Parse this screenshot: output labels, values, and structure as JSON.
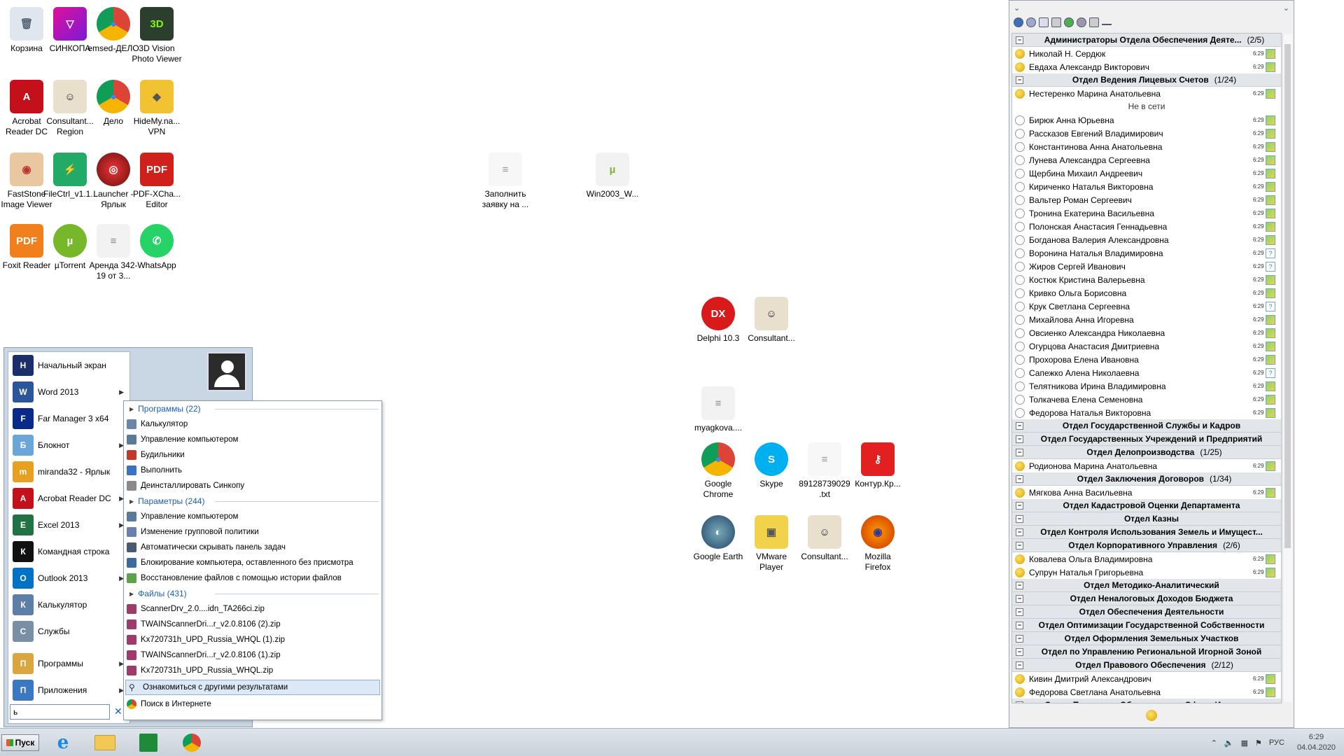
{
  "desktop": {
    "icons": [
      {
        "label": "Корзина",
        "icon": "recycle-bin-icon"
      },
      {
        "label": "СИНКОПА",
        "icon": "sinkopa-icon"
      },
      {
        "label": "emsed-ДЕЛО",
        "icon": "chrome-icon"
      },
      {
        "label": "3D Vision Photo Viewer",
        "icon": "3d-vision-icon"
      },
      {
        "label": "Acrobat Reader DC",
        "icon": "acrobat-icon"
      },
      {
        "label": "Consultant... Region",
        "icon": "consultant-icon"
      },
      {
        "label": "Дело",
        "icon": "chrome-icon"
      },
      {
        "label": "HideMy.na... VPN",
        "icon": "vpn-icon"
      },
      {
        "label": "FastStone Image Viewer",
        "icon": "faststone-icon"
      },
      {
        "label": "FileCtrl_v1.1...",
        "icon": "filectrl-icon"
      },
      {
        "label": "Launcher - Ярлык",
        "icon": "launcher-icon"
      },
      {
        "label": "PDF-XCha... Editor",
        "icon": "pdf-xchange-icon"
      },
      {
        "label": "Foxit Reader",
        "icon": "foxit-icon"
      },
      {
        "label": "µTorrent",
        "icon": "utorrent-icon"
      },
      {
        "label": "Аренда 342-19 от 3...",
        "icon": "document-icon"
      },
      {
        "label": "WhatsApp",
        "icon": "whatsapp-icon"
      },
      {
        "label": "Заполнить заявку на ...",
        "icon": "text-file-icon"
      },
      {
        "label": "Win2003_W...",
        "icon": "torrent-file-icon"
      },
      {
        "label": "Delphi 10.3",
        "icon": "delphi-icon"
      },
      {
        "label": "Consultant...",
        "icon": "consultant-icon"
      },
      {
        "label": "myagkova....",
        "icon": "document-icon"
      },
      {
        "label": "Google Chrome",
        "icon": "chrome-icon"
      },
      {
        "label": "Skype",
        "icon": "skype-icon"
      },
      {
        "label": "89128739029 .txt",
        "icon": "text-file-icon"
      },
      {
        "label": "Контур.Кр...",
        "icon": "kontur-icon"
      },
      {
        "label": "Google Earth",
        "icon": "google-earth-icon"
      },
      {
        "label": "VMware Player",
        "icon": "vmware-icon"
      },
      {
        "label": "Consultant...",
        "icon": "consultant-icon"
      },
      {
        "label": "Mozilla Firefox",
        "icon": "firefox-icon"
      }
    ]
  },
  "start_menu": {
    "items": [
      {
        "label": "Начальный экран",
        "icon": "start-screen-icon",
        "color": "#1c2d6b",
        "submenu": false
      },
      {
        "label": "Word 2013",
        "icon": "word-icon",
        "color": "#2b579a",
        "submenu": true
      },
      {
        "label": "Far Manager 3 x64",
        "icon": "far-manager-icon",
        "color": "#0a2a8a",
        "submenu": false
      },
      {
        "label": "Блокнот",
        "icon": "notepad-icon",
        "color": "#6aa6d8",
        "submenu": true
      },
      {
        "label": "miranda32 - Ярлык",
        "icon": "miranda-icon",
        "color": "#e8a020",
        "submenu": false
      },
      {
        "label": "Acrobat Reader DC",
        "icon": "acrobat-icon",
        "color": "#c4101a",
        "submenu": true
      },
      {
        "label": "Excel 2013",
        "icon": "excel-icon",
        "color": "#217346",
        "submenu": true
      },
      {
        "label": "Командная строка",
        "icon": "cmd-icon",
        "color": "#111111",
        "submenu": false
      },
      {
        "label": "Outlook 2013",
        "icon": "outlook-icon",
        "color": "#0072c6",
        "submenu": true
      },
      {
        "label": "Калькулятор",
        "icon": "calculator-icon",
        "color": "#5b7fa6",
        "submenu": false
      },
      {
        "label": "Службы",
        "icon": "services-icon",
        "color": "#7a8fa6",
        "submenu": false
      }
    ],
    "bottom_items": [
      {
        "label": "Программы",
        "icon": "programs-icon",
        "color": "#d9a640",
        "submenu": true
      },
      {
        "label": "Приложения",
        "icon": "apps-icon",
        "color": "#3b78c2",
        "submenu": true
      }
    ],
    "search_value": "ь",
    "search_clear": "✕"
  },
  "results": {
    "programs_header": "Программы (22)",
    "programs": [
      {
        "label": "Калькулятор",
        "color": "#6b87a8"
      },
      {
        "label": "Управление компьютером",
        "color": "#5a7a99"
      },
      {
        "label": "Будильники",
        "color": "#c0392b"
      },
      {
        "label": "Выполнить",
        "color": "#3b73c4"
      },
      {
        "label": "Деинсталлировать Синкопу",
        "color": "#8a8a8a"
      }
    ],
    "settings_header": "Параметры (244)",
    "settings": [
      {
        "label": "Управление компьютером",
        "color": "#5a7a99"
      },
      {
        "label": "Изменение групповой политики",
        "color": "#6b7fb0"
      },
      {
        "label": "Автоматически скрывать панель задач",
        "color": "#4a5a70"
      },
      {
        "label": "Блокирование компьютера, оставленного без присмотра",
        "color": "#3a6aa0"
      },
      {
        "label": "Восстановление файлов с помощью истории файлов",
        "color": "#5fa04a"
      }
    ],
    "files_header": "Файлы (431)",
    "files": [
      {
        "label": "ScannerDrv_2.0....idn_TA266ci.zip",
        "color": "#a03a6a"
      },
      {
        "label": "TWAINScannerDri...r_v2.0.8106 (2).zip",
        "color": "#a03a6a"
      },
      {
        "label": "Kx720731h_UPD_Russia_WHQL (1).zip",
        "color": "#a03a6a"
      },
      {
        "label": "TWAINScannerDri...r_v2.0.8106 (1).zip",
        "color": "#a03a6a"
      },
      {
        "label": "Kx720731h_UPD_Russia_WHQL.zip",
        "color": "#a03a6a"
      }
    ],
    "more_results": "Ознакомиться с другими результатами",
    "web_search": "Поиск в Интернете"
  },
  "miranda": {
    "offline_separator": "Не в сети",
    "time": "6:29",
    "rows": [
      {
        "type": "group",
        "name": "Администраторы Отдела Обеспечения Деяте...",
        "count": "(2/5)"
      },
      {
        "type": "contact",
        "name": "Николай Н. Сердюк",
        "online": true,
        "q": false
      },
      {
        "type": "contact",
        "name": "Евдаха Александр Викторович",
        "online": true,
        "q": false
      },
      {
        "type": "group",
        "name": "Отдел Ведения Лицевых Счетов",
        "count": "(1/24)"
      },
      {
        "type": "contact",
        "name": "Нестеренко Марина Анатольевна",
        "online": true,
        "q": false
      },
      {
        "type": "sep"
      },
      {
        "type": "contact",
        "name": "Бирюк Анна Юрьевна",
        "online": false,
        "q": false
      },
      {
        "type": "contact",
        "name": "Рассказов Евгений Владимирович",
        "online": false,
        "q": false
      },
      {
        "type": "contact",
        "name": "Константинова Анна Анатольевна",
        "online": false,
        "q": false
      },
      {
        "type": "contact",
        "name": "Лунева Александра Сергеевна",
        "online": false,
        "q": false
      },
      {
        "type": "contact",
        "name": "Щербина Михаил Андреевич",
        "online": false,
        "q": false
      },
      {
        "type": "contact",
        "name": "Кириченко Наталья Викторовна",
        "online": false,
        "q": false
      },
      {
        "type": "contact",
        "name": "Вальтер Роман Сергеевич",
        "online": false,
        "q": false
      },
      {
        "type": "contact",
        "name": "Тронина Екатерина Васильевна",
        "online": false,
        "q": false
      },
      {
        "type": "contact",
        "name": "Полонская Анастасия Геннадьевна",
        "online": false,
        "q": false
      },
      {
        "type": "contact",
        "name": "Богданова Валерия Александровна",
        "online": false,
        "q": false
      },
      {
        "type": "contact",
        "name": "Воронина Наталья Владимировна",
        "online": false,
        "q": true
      },
      {
        "type": "contact",
        "name": "Жиров Сергей Иванович",
        "online": false,
        "q": true
      },
      {
        "type": "contact",
        "name": "Костюк Кристина Валерьевна",
        "online": false,
        "q": false
      },
      {
        "type": "contact",
        "name": "Кривко Ольга Борисовна",
        "online": false,
        "q": false
      },
      {
        "type": "contact",
        "name": "Крук Светлана Сергеевна",
        "online": false,
        "q": true
      },
      {
        "type": "contact",
        "name": "Михайлова Анна Игоревна",
        "online": false,
        "q": false
      },
      {
        "type": "contact",
        "name": "Овсиенко Александра Николаевна",
        "online": false,
        "q": false
      },
      {
        "type": "contact",
        "name": "Огурцова Анастасия Дмитриевна",
        "online": false,
        "q": false
      },
      {
        "type": "contact",
        "name": "Прохорова Елена Ивановна",
        "online": false,
        "q": false
      },
      {
        "type": "contact",
        "name": "Сапежко Алена Николаевна",
        "online": false,
        "q": true
      },
      {
        "type": "contact",
        "name": "Телятникова Ирина Владимировна",
        "online": false,
        "q": false
      },
      {
        "type": "contact",
        "name": "Толкачева Елена Семеновна",
        "online": false,
        "q": false
      },
      {
        "type": "contact",
        "name": "Федорова Наталья Викторовна",
        "online": false,
        "q": false
      },
      {
        "type": "group",
        "name": "Отдел Государственной Службы и Кадров",
        "count": ""
      },
      {
        "type": "group",
        "name": "Отдел Государственных Учреждений и Предприятий",
        "count": ""
      },
      {
        "type": "group",
        "name": "Отдел Делопроизводства",
        "count": "(1/25)"
      },
      {
        "type": "contact",
        "name": "Родионова Марина Анатольевна",
        "online": true,
        "q": false
      },
      {
        "type": "group",
        "name": "Отдел Заключения Договоров",
        "count": "(1/34)"
      },
      {
        "type": "contact",
        "name": "Мягкова Анна Васильевна",
        "online": true,
        "q": false
      },
      {
        "type": "group",
        "name": "Отдел Кадастровой Оценки Департамента",
        "count": ""
      },
      {
        "type": "group",
        "name": "Отдел Казны",
        "count": ""
      },
      {
        "type": "group",
        "name": "Отдел Контроля Использования Земель и Имущест...",
        "count": ""
      },
      {
        "type": "group",
        "name": "Отдел Корпоративного Управления",
        "count": "(2/6)"
      },
      {
        "type": "contact",
        "name": "Ковалева Ольга Владимировна",
        "online": true,
        "q": false
      },
      {
        "type": "contact",
        "name": "Супрун Наталья Григорьевна",
        "online": true,
        "q": false
      },
      {
        "type": "group",
        "name": "Отдел Методико-Аналитический",
        "count": ""
      },
      {
        "type": "group",
        "name": "Отдел Неналоговых Доходов Бюджета",
        "count": ""
      },
      {
        "type": "group",
        "name": "Отдел Обеспечения Деятельности",
        "count": ""
      },
      {
        "type": "group",
        "name": "Отдел Оптимизации Государственной Собственности",
        "count": ""
      },
      {
        "type": "group",
        "name": "Отдел Оформления Земельных Участков",
        "count": ""
      },
      {
        "type": "group",
        "name": "Отдел по Управлению Региональной Игорной Зоной",
        "count": ""
      },
      {
        "type": "group",
        "name": "Отдел Правового Обеспечения",
        "count": "(2/12)"
      },
      {
        "type": "contact",
        "name": "Кивин Дмитрий Александрович",
        "online": true,
        "q": false
      },
      {
        "type": "contact",
        "name": "Федорова Светлана Анатольевна",
        "online": true,
        "q": false
      },
      {
        "type": "group",
        "name": "Отдел Правового Обеспечения в Сфере Имущест...",
        "count": ""
      }
    ]
  },
  "taskbar": {
    "start_label": "Пуск",
    "lang": "РУС",
    "time": "6:29",
    "date": "04.04.2020"
  }
}
